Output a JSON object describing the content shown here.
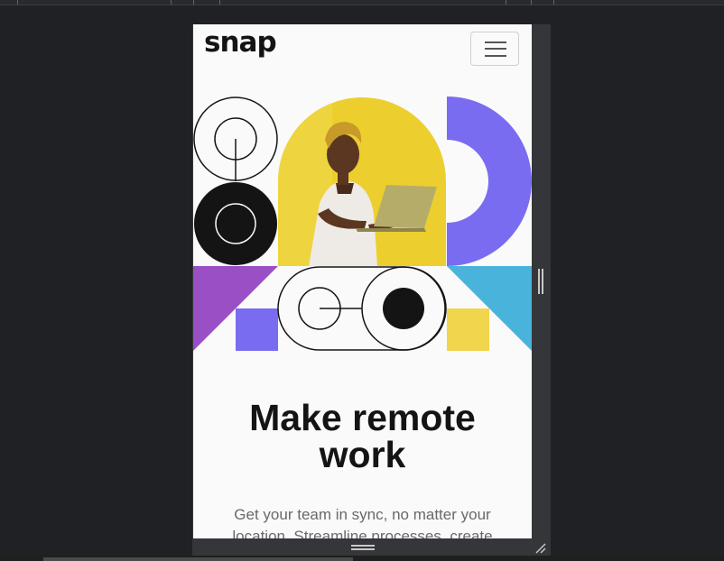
{
  "page": {
    "logo": "snap",
    "menu_button": {
      "icon": "hamburger-menu-icon"
    },
    "hero": {
      "title_line1": "Make remote",
      "title_line2": "work",
      "description": "Get your team in sync, no matter your location. Streamline processes, create"
    }
  },
  "colors": {
    "page_background": "#fafafa",
    "text_dark": "#141414",
    "text_muted": "#69696b",
    "yellow": "#f1d54d",
    "purple": "#7a6cf0",
    "violet": "#9b4fc4",
    "cyan": "#4ab3dc",
    "devtools_background": "#202124"
  }
}
